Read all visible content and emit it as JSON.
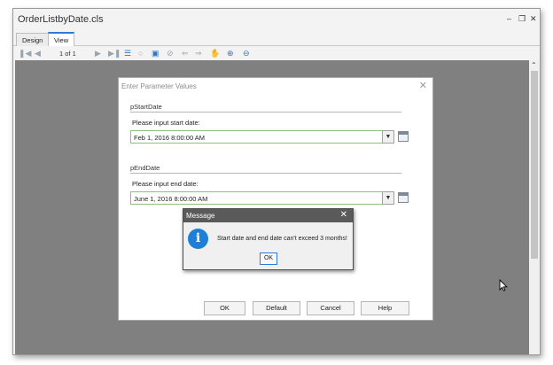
{
  "window": {
    "title": "OrderListbyDate.cls"
  },
  "tabs": [
    {
      "label": "Design"
    },
    {
      "label": "View"
    }
  ],
  "toolbar": {
    "page_count": "1 of 1"
  },
  "param_dialog": {
    "title": "Enter Parameter Values",
    "start": {
      "section": "pStartDate",
      "prompt": "Please input start date:",
      "value": "Feb 1, 2016 8:00:00 AM"
    },
    "end": {
      "section": "pEndDate",
      "prompt": "Please input end date:",
      "value": "June 1, 2016 8:00:00 AM"
    },
    "buttons": {
      "ok": "OK",
      "default": "Default",
      "cancel": "Cancel",
      "help": "Help"
    }
  },
  "message_dialog": {
    "title": "Message",
    "text": "Start date and end date can't exceed 3 months!",
    "ok": "OK"
  },
  "colors": {
    "accent": "#2c7bd6",
    "info": "#1e7fd8",
    "viewer_bg": "#808080",
    "message_titlebar": "#5a5a5a"
  }
}
